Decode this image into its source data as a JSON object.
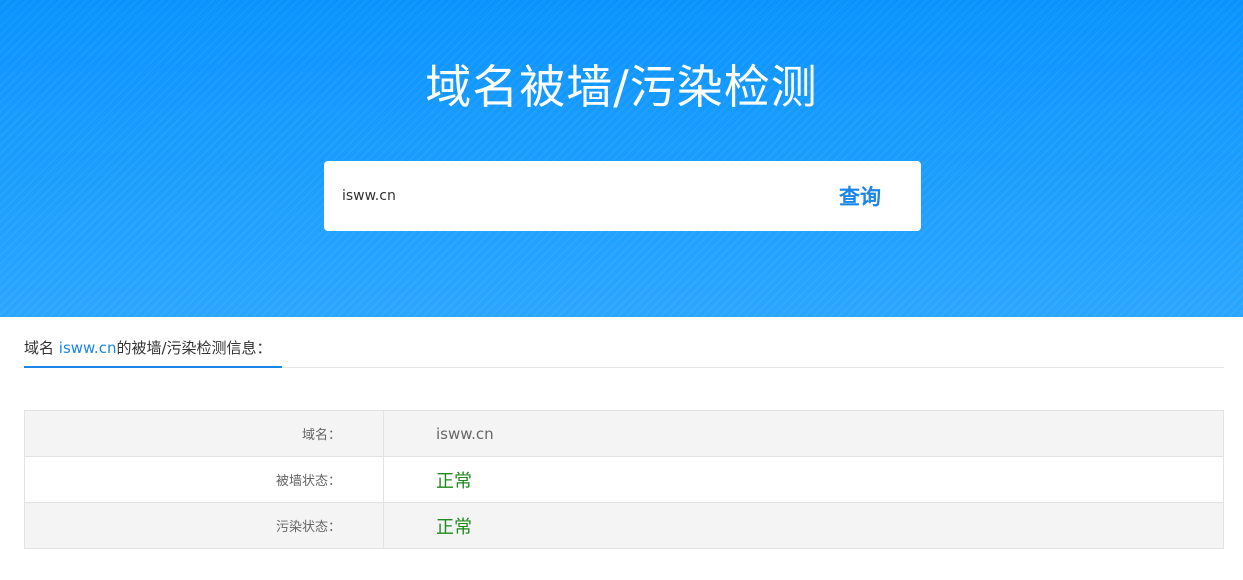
{
  "hero": {
    "title": "域名被墙/污染检测"
  },
  "search": {
    "value": "isww.cn",
    "button_label": "查询"
  },
  "result_header": {
    "prefix": "域名 ",
    "domain": "isww.cn",
    "suffix": "的被墙/污染检测信息："
  },
  "result_table": {
    "rows": [
      {
        "label": "域名：",
        "value": "isww.cn"
      },
      {
        "label": "被墙状态：",
        "value": "正常"
      },
      {
        "label": "污染状态：",
        "value": "正常"
      }
    ]
  },
  "colors": {
    "hero_top": "#0a93ff",
    "hero_bottom": "#2aa6ff",
    "accent": "#1a86e8",
    "status_ok": "#1f8a1f"
  }
}
